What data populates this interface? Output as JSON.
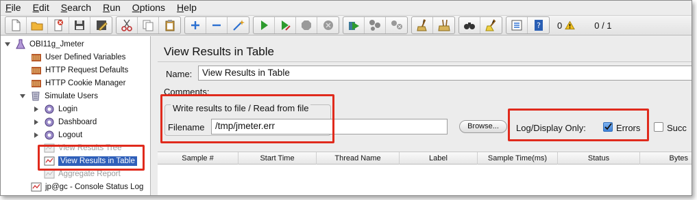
{
  "menubar": {
    "items": [
      {
        "key": "F",
        "rest": "ile"
      },
      {
        "key": "E",
        "rest": "dit"
      },
      {
        "key": "S",
        "rest": "earch"
      },
      {
        "key": "R",
        "rest": "un"
      },
      {
        "key": "O",
        "rest": "ptions"
      },
      {
        "key": "H",
        "rest": "elp"
      }
    ]
  },
  "toolbar": {
    "error_count": "0",
    "thread_status": "0 / 1",
    "colors": {
      "start": "#2e9b2e",
      "stop": "#9a9a9a",
      "add": "#2a6fd1",
      "remove": "#2a6fd1",
      "cut": "#c03030"
    }
  },
  "tree": {
    "nodes": [
      {
        "label": "OBI11g_Jmeter",
        "icon": "flask-icon",
        "toggle": "expanded"
      },
      {
        "label": "User Defined Variables",
        "icon": "config-element-icon",
        "toggle": ""
      },
      {
        "label": "HTTP Request Defaults",
        "icon": "config-element-icon",
        "toggle": ""
      },
      {
        "label": "HTTP Cookie Manager",
        "icon": "config-element-icon",
        "toggle": ""
      },
      {
        "label": "Simulate Users",
        "icon": "thread-group-icon",
        "toggle": "expanded"
      },
      {
        "label": "Login",
        "icon": "controller-icon",
        "toggle": "collapsed"
      },
      {
        "label": "Dashboard",
        "icon": "controller-icon",
        "toggle": "collapsed"
      },
      {
        "label": "Logout",
        "icon": "controller-icon",
        "toggle": "collapsed"
      },
      {
        "label": "View Results Tree",
        "icon": "listener-icon",
        "toggle": "",
        "state": "disabled"
      },
      {
        "label": "View Results in Table",
        "icon": "listener-icon",
        "toggle": "",
        "state": "selected"
      },
      {
        "label": "Aggregate Report",
        "icon": "listener-icon",
        "toggle": "",
        "state": "disabled"
      },
      {
        "label": "jp@gc - Console Status Log",
        "icon": "listener-icon",
        "toggle": ""
      }
    ]
  },
  "panel": {
    "title": "View Results in Table",
    "name_label": "Name:",
    "name_value": "View Results in Table",
    "comments_label": "Comments:",
    "file_group_title": "Write results to file / Read from file",
    "filename_label": "Filename",
    "filename_value": "/tmp/jmeter.err",
    "browse_label": "Browse...",
    "log_display_label": "Log/Display Only:",
    "errors_label": "Errors",
    "errors_checked": true,
    "successes_label": "Succ",
    "successes_checked": false
  },
  "table": {
    "columns": [
      "Sample #",
      "Start Time",
      "Thread Name",
      "Label",
      "Sample Time(ms)",
      "Status",
      "Bytes"
    ]
  },
  "callout_color": "#e02a1c"
}
